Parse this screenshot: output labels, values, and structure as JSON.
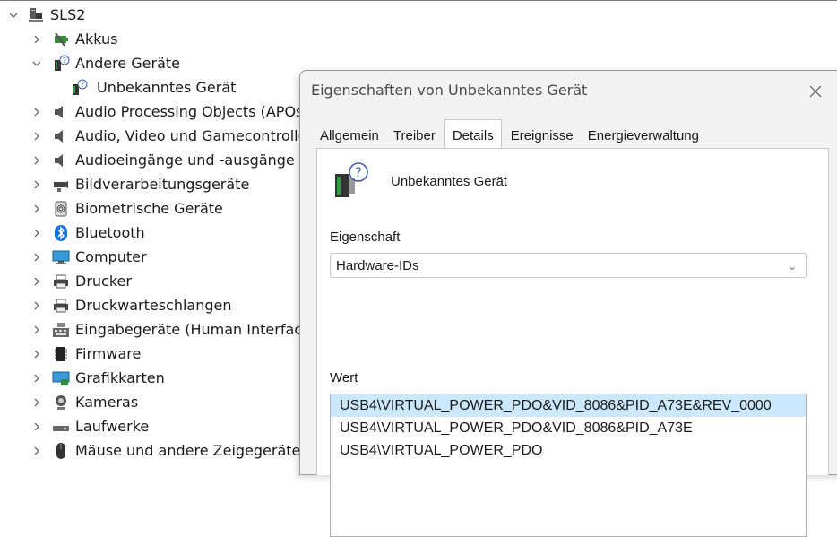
{
  "tree": {
    "root": {
      "label": "SLS2",
      "icon": "computer-tower-icon",
      "expanded": true
    },
    "items": [
      {
        "label": "Akkus",
        "icon": "battery-icon",
        "expanded": false
      },
      {
        "label": "Andere Geräte",
        "icon": "unknown-device-icon",
        "expanded": true
      },
      {
        "label": "Unbekanntes Gerät",
        "icon": "unknown-device-icon",
        "child": true
      },
      {
        "label": "Audio Processing Objects (APOs)",
        "icon": "speaker-icon",
        "expanded": false
      },
      {
        "label": "Audio, Video und Gamecontroller",
        "icon": "speaker-icon",
        "expanded": false
      },
      {
        "label": "Audioeingänge und -ausgänge",
        "icon": "speaker-icon",
        "expanded": false
      },
      {
        "label": "Bildverarbeitungsgeräte",
        "icon": "camera-device-icon",
        "expanded": false
      },
      {
        "label": "Biometrische Geräte",
        "icon": "fingerprint-icon",
        "expanded": false
      },
      {
        "label": "Bluetooth",
        "icon": "bluetooth-icon",
        "expanded": false
      },
      {
        "label": "Computer",
        "icon": "monitor-icon",
        "expanded": false
      },
      {
        "label": "Drucker",
        "icon": "printer-icon",
        "expanded": false
      },
      {
        "label": "Druckwarteschlangen",
        "icon": "printer-icon",
        "expanded": false
      },
      {
        "label": "Eingabegeräte (Human Interface Devices)",
        "icon": "keyboard-icon",
        "expanded": false
      },
      {
        "label": "Firmware",
        "icon": "chip-icon",
        "expanded": false
      },
      {
        "label": "Grafikkarten",
        "icon": "display-adapter-icon",
        "expanded": false
      },
      {
        "label": "Kameras",
        "icon": "webcam-icon",
        "expanded": false
      },
      {
        "label": "Laufwerke",
        "icon": "drive-icon",
        "expanded": false
      },
      {
        "label": "Mäuse und andere Zeigegeräte",
        "icon": "mouse-icon",
        "expanded": false
      }
    ]
  },
  "dialog": {
    "title": "Eigenschaften von Unbekanntes Gerät",
    "tabs": [
      "Allgemein",
      "Treiber",
      "Details",
      "Ereignisse",
      "Energieverwaltung"
    ],
    "active_tab": "Details",
    "device_name": "Unbekanntes Gerät",
    "property_label": "Eigenschaft",
    "property_value": "Hardware-IDs",
    "value_label": "Wert",
    "values": [
      "USB4\\VIRTUAL_POWER_PDO&VID_8086&PID_A73E&REV_0000",
      "USB4\\VIRTUAL_POWER_PDO&VID_8086&PID_A73E",
      "USB4\\VIRTUAL_POWER_PDO"
    ],
    "selected_value_index": 0
  },
  "colors": {
    "selection": "#cce8ff",
    "dialog_bg": "#f3f3f3",
    "bluetooth": "#1a73e8"
  }
}
